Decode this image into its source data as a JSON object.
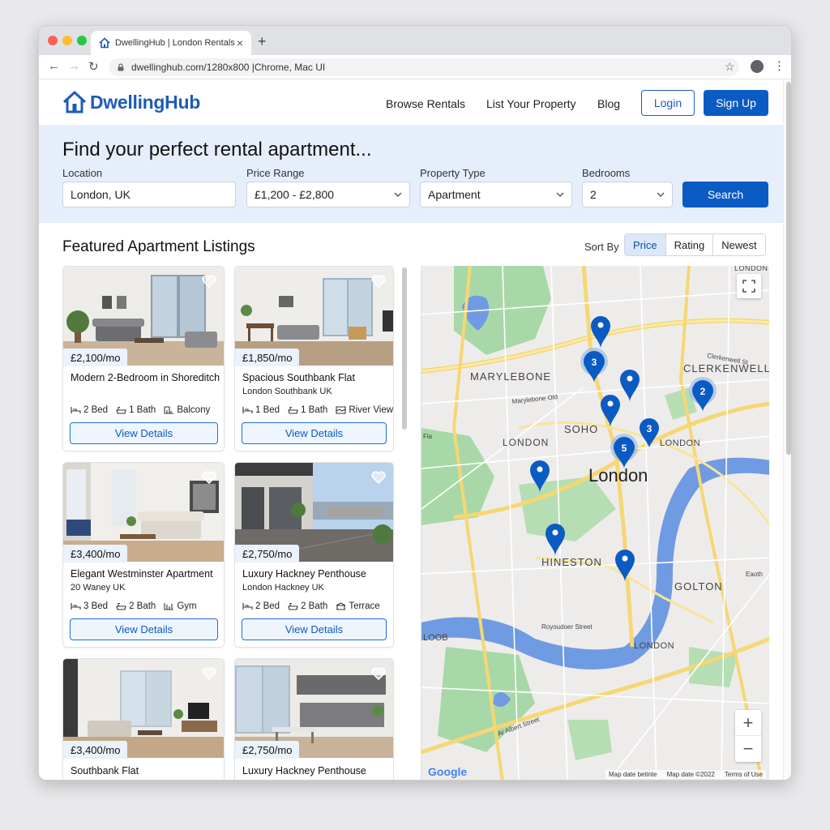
{
  "browser": {
    "tab_title": "DwellingHub | London Rentals",
    "url": "dwellinghub.com/1280x800 |Chrome, Mac UI"
  },
  "site": {
    "logo": "DwellingHub",
    "nav": [
      "Browse Rentals",
      "List Your Property",
      "Blog"
    ],
    "login": "Login",
    "signup": "Sign Up"
  },
  "search": {
    "title": "Find your perfect rental apartment...",
    "location_label": "Location",
    "location_value": "London, UK",
    "price_label": "Price Range",
    "price_value": "£1,200 - £2,800",
    "type_label": "Property Type",
    "type_value": "Apartment",
    "bedrooms_label": "Bedrooms",
    "bedrooms_value": "2",
    "button": "Search"
  },
  "listings_section": {
    "title": "Featured Apartment Listings",
    "sort_label": "Sort By",
    "sort_options": [
      "Price",
      "Rating",
      "Newest"
    ],
    "sort_active": "Price"
  },
  "listings": [
    {
      "price": "£2,100/mo",
      "title": "Modern 2-Bedroom in Shoreditch",
      "subtitle": "",
      "beds": "2 Bed",
      "baths": "1 Bath",
      "extra": "Balcony",
      "button": "View Details"
    },
    {
      "price": "£1,850/mo",
      "title": "Spacious Southbank Flat",
      "subtitle": "London Southbank UK",
      "beds": "1 Bed",
      "baths": "1 Bath",
      "extra": "River View",
      "button": "View Details"
    },
    {
      "price": "£3,400/mo",
      "title": "Elegant Westminster Apartment",
      "subtitle": "20 Waney UK",
      "beds": "3 Bed",
      "baths": "2 Bath",
      "extra": "Gym",
      "button": "View Details"
    },
    {
      "price": "£2,750/mo",
      "title": "Luxury Hackney Penthouse",
      "subtitle": "London Hackney UK",
      "beds": "2 Bed",
      "baths": "2 Bath",
      "extra": "Terrace",
      "button": "View Details"
    },
    {
      "price": "£3,400/mo",
      "title": "Southbank Flat",
      "subtitle": "",
      "beds": "",
      "baths": "",
      "extra": "",
      "button": ""
    },
    {
      "price": "£2,750/mo",
      "title": "Luxury Hackney Penthouse",
      "subtitle": "",
      "beds": "",
      "baths": "",
      "extra": "",
      "button": ""
    }
  ],
  "map": {
    "areas": [
      "MARYLEBONE",
      "CLERKENWELL",
      "SOHO",
      "LONDON",
      "LONDON",
      "London",
      "HINESTON",
      "GOLTON",
      "LONDON",
      "LONDON",
      "LOOB"
    ],
    "streets": [
      "Marylebone Old",
      "Clerkenwell St",
      "Royoudoer Street",
      "Ar Albert Street",
      "Fla",
      "Eaoth"
    ],
    "clusters": [
      "3",
      "2",
      "3",
      "5"
    ],
    "zoom_in": "+",
    "zoom_out": "−",
    "attribution": [
      "Map date betinte",
      "Map date ©2022",
      "Terms of Use"
    ],
    "brand": "Google"
  },
  "colors": {
    "brand": "#1e5bb8",
    "primary_button": "#0b5bc4",
    "search_bg": "#e5eefa",
    "map_water": "#6f9be3",
    "map_park": "#a8d8a8",
    "pin": "#0b5bc4"
  },
  "icons": [
    "house-logo-icon",
    "heart-icon",
    "bed-icon",
    "bath-icon",
    "balcony-icon",
    "chevron-down-icon",
    "map-pin-icon",
    "expand-icon",
    "lock-icon",
    "star-icon"
  ]
}
